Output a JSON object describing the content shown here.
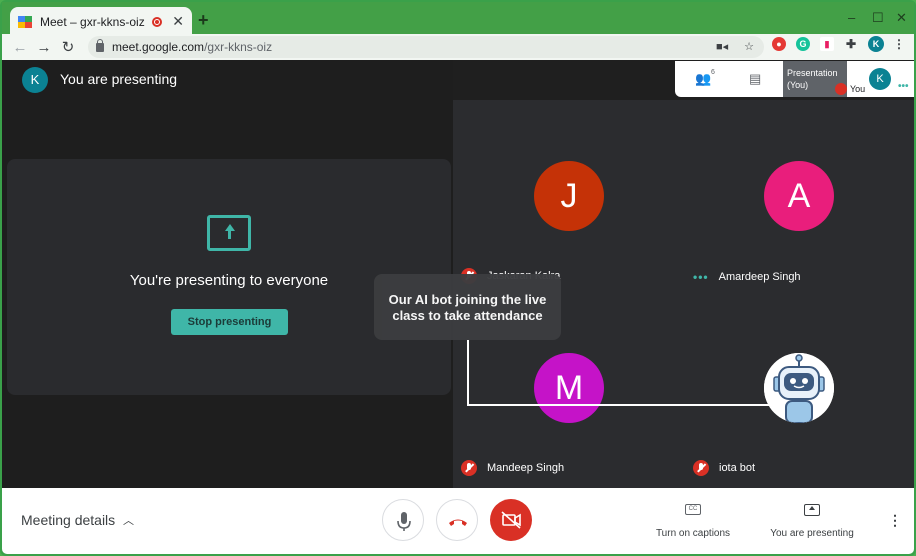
{
  "browser": {
    "tab_title": "Meet – gxr-kkns-oiz",
    "tab_close": "✕",
    "new_tab": "+",
    "url_host": "meet.google.com",
    "url_path": "/gxr-kkns-oiz",
    "avatar_initial": "K"
  },
  "header": {
    "avatar_initial": "K",
    "label": "You are presenting"
  },
  "presenting_card": {
    "message": "You're presenting to everyone",
    "stop_button": "Stop presenting"
  },
  "participants_panel": {
    "people_count": "6",
    "thumb_line1": "Presentation",
    "thumb_line2": "(You)",
    "you_label": "You",
    "you_initial": "K",
    "dots": "•••"
  },
  "tiles": [
    {
      "initial": "J",
      "name": "Jaskaran Kalra",
      "color": "#c53207",
      "muted": true
    },
    {
      "initial": "A",
      "name": "Amardeep Singh",
      "color": "#e91e7c",
      "muted": false
    },
    {
      "initial": "M",
      "name": "Mandeep Singh",
      "color": "#c513c8",
      "muted": true
    },
    {
      "initial": "",
      "name": "iota bot",
      "color": "#ffffff",
      "muted": true
    }
  ],
  "annotation": {
    "text_line1": "Our AI bot joining the live",
    "text_line2": "class to take attendance"
  },
  "bottom_bar": {
    "meeting_details": "Meeting details",
    "captions_label": "Turn on captions",
    "presenting_label": "You are presenting",
    "cc_icon": "CC"
  },
  "colors": {
    "accent_teal": "#3fb6a8",
    "danger_red": "#d93025",
    "frame_green": "#43a047"
  }
}
